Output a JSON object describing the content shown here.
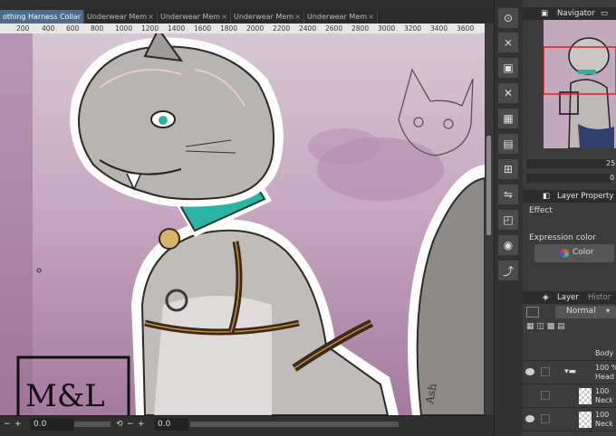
{
  "tabs": [
    {
      "label": "othing Harness Collar",
      "active": true
    },
    {
      "label": "Underwear Mem",
      "active": false
    },
    {
      "label": "Underwear Mem",
      "active": false
    },
    {
      "label": "Underwear Mem",
      "active": false
    },
    {
      "label": "Underwear Mem",
      "active": false
    }
  ],
  "ruler": [
    "200",
    "400",
    "600",
    "800",
    "1000",
    "1200",
    "1400",
    "1600",
    "1800",
    "2000",
    "2200",
    "2400",
    "2600",
    "2800",
    "3000",
    "3200",
    "3400",
    "3600"
  ],
  "canvas": {
    "signature": "M&L",
    "side_signature": "Ash"
  },
  "bottombar": {
    "zoom_value": "0.0",
    "zoom_minus": "−",
    "zoom_plus": "+",
    "rotation_value": "0.0",
    "rotation_minus": "−",
    "rotation_plus": "+"
  },
  "panels": {
    "navigator": {
      "title": "Navigator",
      "zoom_value": "25",
      "rotation_value": "0"
    },
    "layer_property": {
      "title": "Layer Property",
      "effect_label": "Effect",
      "expression_color_label": "Expression color",
      "color_button": "Color"
    },
    "layer": {
      "title": "Layer",
      "history_tab": "Histor",
      "blend_mode": "Normal",
      "layers": [
        {
          "name": "Body",
          "opacity": ""
        },
        {
          "name": "Head",
          "opacity": "100 %"
        },
        {
          "name": "Neck",
          "opacity": "100"
        },
        {
          "name": "Neck",
          "opacity": "100"
        }
      ]
    }
  },
  "colors": {
    "tab_active": "#4a6d8c",
    "collar": "#2bb3a3",
    "background_pink": "#c7a8c2",
    "panel_bg": "#3c3c3c"
  }
}
